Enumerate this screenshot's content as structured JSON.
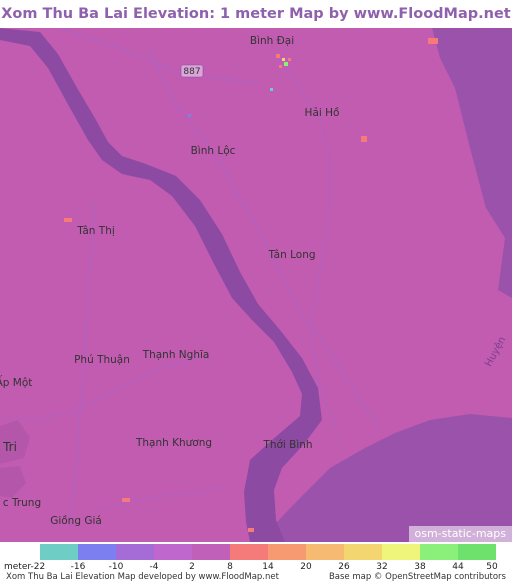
{
  "title": "Xom Thu Ba Lai Elevation: 1 meter Map by www.FloodMap.net (beta)",
  "map": {
    "road_badge": "887",
    "places": [
      {
        "key": "binh_dai",
        "name": "Bình Đại"
      },
      {
        "key": "hai_ho",
        "name": "Hải Hồ"
      },
      {
        "key": "binh_loc",
        "name": "Bình Lộc"
      },
      {
        "key": "tan_thi",
        "name": "Tân Thị"
      },
      {
        "key": "tan_long",
        "name": "Tân Long"
      },
      {
        "key": "phu_thuan",
        "name": "Phú Thuận"
      },
      {
        "key": "thanh_nghia",
        "name": "Thạnh Nghĩa"
      },
      {
        "key": "ap_mot",
        "name": "Ấp Một"
      },
      {
        "key": "tri",
        "name": "Tri"
      },
      {
        "key": "thanh_khuong",
        "name": "Thạnh Khương"
      },
      {
        "key": "thoi_binh",
        "name": "Thới Bình"
      },
      {
        "key": "c_trung",
        "name": "c Trung"
      },
      {
        "key": "giong_gia",
        "name": "Giồng Giá"
      },
      {
        "key": "huyen",
        "name": "Huyện"
      }
    ],
    "osm_badge": "osm-static-maps",
    "colors": {
      "land": "#c25cb0",
      "water": "#9a52ab",
      "river": "#8d4aa3"
    }
  },
  "legend": {
    "unit_label": "meter",
    "ticks": [
      "-22",
      "-16",
      "-10",
      "-4",
      "2",
      "8",
      "14",
      "20",
      "26",
      "32",
      "38",
      "44",
      "50"
    ],
    "colors": [
      "#6ecdc4",
      "#7b7ff0",
      "#a56bd6",
      "#c067cd",
      "#c060b8",
      "#f57a7a",
      "#f79a72",
      "#f6ba72",
      "#f3d670",
      "#eef57a",
      "#8af07a",
      "#6ee06c"
    ]
  },
  "footer": {
    "left": "Xom Thu Ba Lai Elevation Map developed by www.FloodMap.net",
    "right": "Base map © OpenStreetMap contributors"
  }
}
